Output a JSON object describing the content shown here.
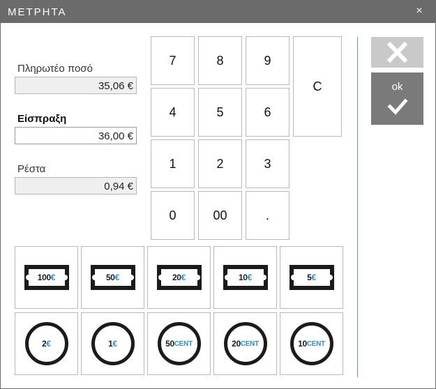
{
  "window": {
    "title": "ΜΕΤΡΗΤΑ",
    "close_symbol": "×"
  },
  "amounts": {
    "payable_label": "Πληρωτέο ποσό",
    "payable_value": "35,06 €",
    "received_label": "Είσπραξη",
    "received_value": "36,00 €",
    "change_label": "Ρέστα",
    "change_value": "0,94 €"
  },
  "keypad": {
    "keys": [
      "7",
      "8",
      "9",
      "4",
      "5",
      "6",
      "1",
      "2",
      "3",
      "0",
      "00",
      "."
    ],
    "clear": "C"
  },
  "actions": {
    "ok_label": "ok",
    "cancel_icon": "x-icon",
    "ok_icon": "checkmark-icon"
  },
  "notes": [
    {
      "amount": "100",
      "currency": "€"
    },
    {
      "amount": "50",
      "currency": "€"
    },
    {
      "amount": "20",
      "currency": "€"
    },
    {
      "amount": "10",
      "currency": "€"
    },
    {
      "amount": "5",
      "currency": "€"
    }
  ],
  "coins": [
    {
      "amount": "2",
      "currency": "€"
    },
    {
      "amount": "1",
      "currency": "€"
    },
    {
      "amount": "50",
      "currency": "CENT"
    },
    {
      "amount": "20",
      "currency": "CENT"
    },
    {
      "amount": "10",
      "currency": "CENT"
    }
  ],
  "colors": {
    "titlebar": "#6b6b6b",
    "euro_accent": "#2a8fd6",
    "separator": "#5e95b8",
    "ok_button": "#7a7a7a",
    "cancel_button": "#c9c9c9"
  }
}
